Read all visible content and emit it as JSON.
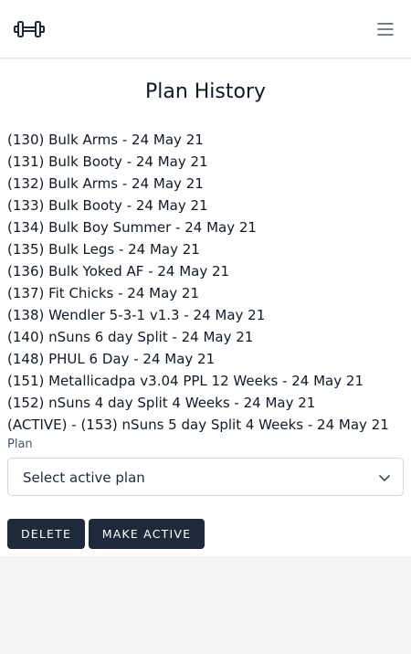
{
  "header": {
    "logo_icon": "dumbbell-icon",
    "menu_icon": "hamburger-menu-icon"
  },
  "main": {
    "title": "Plan History",
    "plans": [
      "(130) Bulk Arms - 24 May 21",
      "(131) Bulk Booty - 24 May 21",
      "(132) Bulk Arms - 24 May 21",
      "(133) Bulk Booty - 24 May 21",
      "(134) Bulk Boy Summer - 24 May 21",
      "(135) Bulk Legs - 24 May 21",
      "(136) Bulk Yoked AF - 24 May 21",
      "(137) Fit Chicks - 24 May 21",
      "(138) Wendler 5-3-1 v1.3 - 24 May 21",
      "(140) nSuns 6 day Split - 24 May 21",
      "(148) PHUL 6 Day - 24 May 21",
      "(151) Metallicadpa v3.04 PPL 12 Weeks - 24 May 21",
      "(152) nSuns 4 day Split 4 Weeks - 24 May 21",
      "(ACTIVE) - (153) nSuns 5 day Split 4 Weeks - 24 May 21"
    ],
    "plan_field": {
      "label": "Plan",
      "selected_value": "Select active plan"
    },
    "buttons": {
      "delete_label": "Delete",
      "make_active_label": "Make Active"
    }
  },
  "colors": {
    "button_bg": "#1e293b",
    "page_bg": "#f3f4f6",
    "card_bg": "#ffffff"
  }
}
